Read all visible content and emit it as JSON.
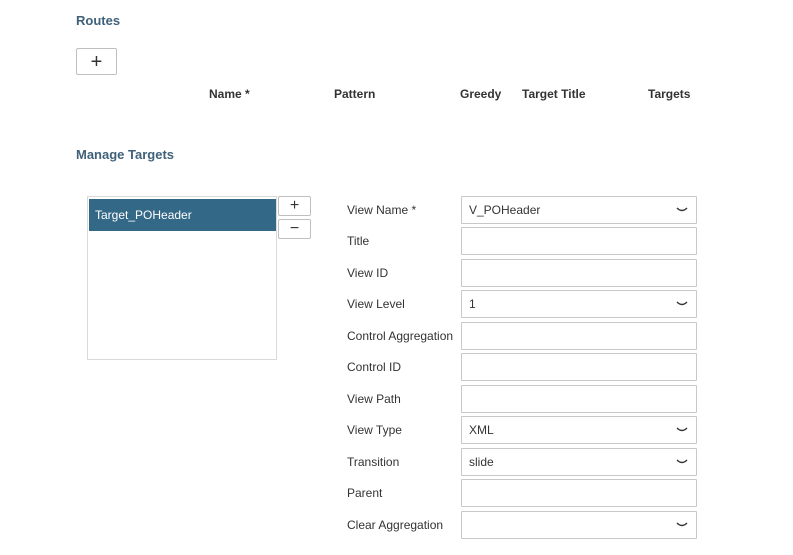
{
  "routes": {
    "title": "Routes",
    "add_label": "+",
    "columns": [
      "Name *",
      "Pattern",
      "Greedy",
      "Target Title",
      "Targets"
    ]
  },
  "manage_targets": {
    "title": "Manage Targets",
    "targets": [
      "Target_POHeader"
    ],
    "add_label": "+",
    "remove_label": "−",
    "form": {
      "view_name": {
        "label": "View Name *",
        "value": "V_POHeader"
      },
      "title": {
        "label": "Title",
        "value": ""
      },
      "view_id": {
        "label": "View ID",
        "value": ""
      },
      "view_level": {
        "label": "View Level",
        "value": "1"
      },
      "control_aggregation": {
        "label": "Control Aggregation",
        "value": ""
      },
      "control_id": {
        "label": "Control ID",
        "value": ""
      },
      "view_path": {
        "label": "View Path",
        "value": ""
      },
      "view_type": {
        "label": "View Type",
        "value": "XML"
      },
      "transition": {
        "label": "Transition",
        "value": "slide"
      },
      "parent": {
        "label": "Parent",
        "value": ""
      },
      "clear_aggregation": {
        "label": "Clear Aggregation",
        "value": ""
      }
    }
  },
  "colors": {
    "section_title": "#3f6179",
    "selected_item_bg": "#346887",
    "border": "#c8c8c8"
  },
  "icons": {
    "add": "plus-icon",
    "remove": "minus-icon",
    "dropdown": "chevron-down-icon"
  }
}
